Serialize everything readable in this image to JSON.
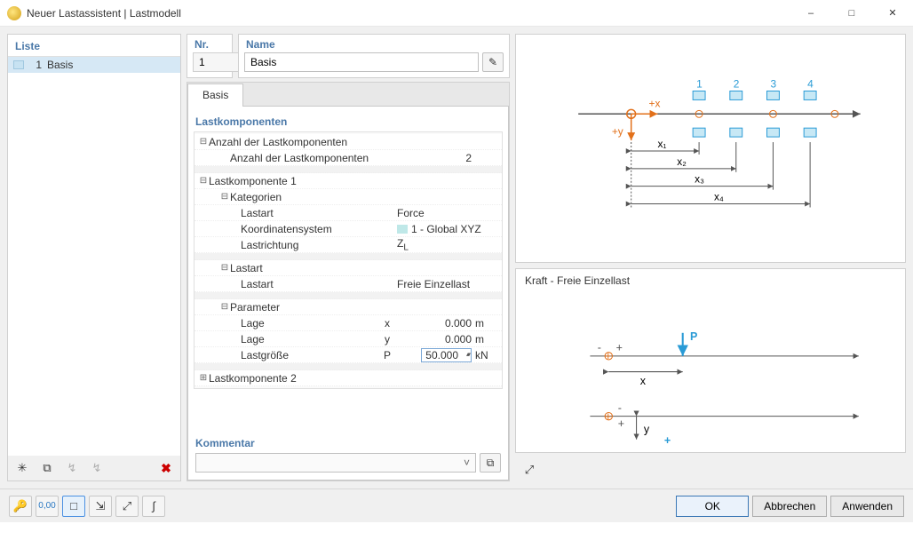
{
  "window": {
    "title": "Neuer Lastassistent | Lastmodell"
  },
  "list": {
    "header": "Liste",
    "items": [
      {
        "number": "1",
        "label": "Basis"
      }
    ]
  },
  "left_toolbar": {
    "new_icon": "✧",
    "duplicate_icon": "⧉",
    "b1_icon": "↯",
    "b2_icon": "↯",
    "delete_icon": "✖"
  },
  "nr": {
    "label": "Nr.",
    "value": "1"
  },
  "name": {
    "label": "Name",
    "value": "Basis",
    "edit_icon": "✎"
  },
  "tabs": [
    {
      "label": "Basis"
    }
  ],
  "props": {
    "group": "Lastkomponenten",
    "count_section": "Anzahl der Lastkomponenten",
    "count_label": "Anzahl der Lastkomponenten",
    "count_value": "2",
    "comp1": {
      "header": "Lastkomponente 1",
      "cat_header": "Kategorien",
      "lastart_label": "Lastart",
      "lastart_value": "Force",
      "coord_label": "Koordinatensystem",
      "coord_value": "1 - Global XYZ",
      "dir_label": "Lastrichtung",
      "dir_value": "Z",
      "dir_sub": "L",
      "type_header": "Lastart",
      "type_label": "Lastart",
      "type_value": "Freie Einzellast",
      "param_header": "Parameter",
      "lage_label": "Lage",
      "lage_x_sym": "x",
      "lage_x_val": "0.000",
      "lage_x_unit": "m",
      "lage_y_sym": "y",
      "lage_y_val": "0.000",
      "lage_y_unit": "m",
      "mag_label": "Lastgröße",
      "mag_sym": "P",
      "mag_val": "50.000",
      "mag_unit": "kN"
    },
    "comp2": {
      "header": "Lastkomponente 2"
    }
  },
  "comment": {
    "label": "Kommentar",
    "value": "",
    "copy_icon": "⧉"
  },
  "diagram_top": {
    "labels": [
      "1",
      "2",
      "3",
      "4"
    ],
    "axisx": "+x",
    "axisy": "+y",
    "dims": [
      "x₁",
      "x₂",
      "x₃",
      "x₄"
    ]
  },
  "diagram_bot": {
    "title": "Kraft - Freie Einzellast",
    "p": "P",
    "x": "x",
    "y": "y"
  },
  "right_toolbar": {
    "btn": "⤢"
  },
  "footer": {
    "ftbtns": [
      "🔑",
      "0,00",
      "□",
      "⇲",
      "⤢",
      "∫"
    ],
    "ok": "OK",
    "cancel": "Abbrechen",
    "apply": "Anwenden"
  }
}
